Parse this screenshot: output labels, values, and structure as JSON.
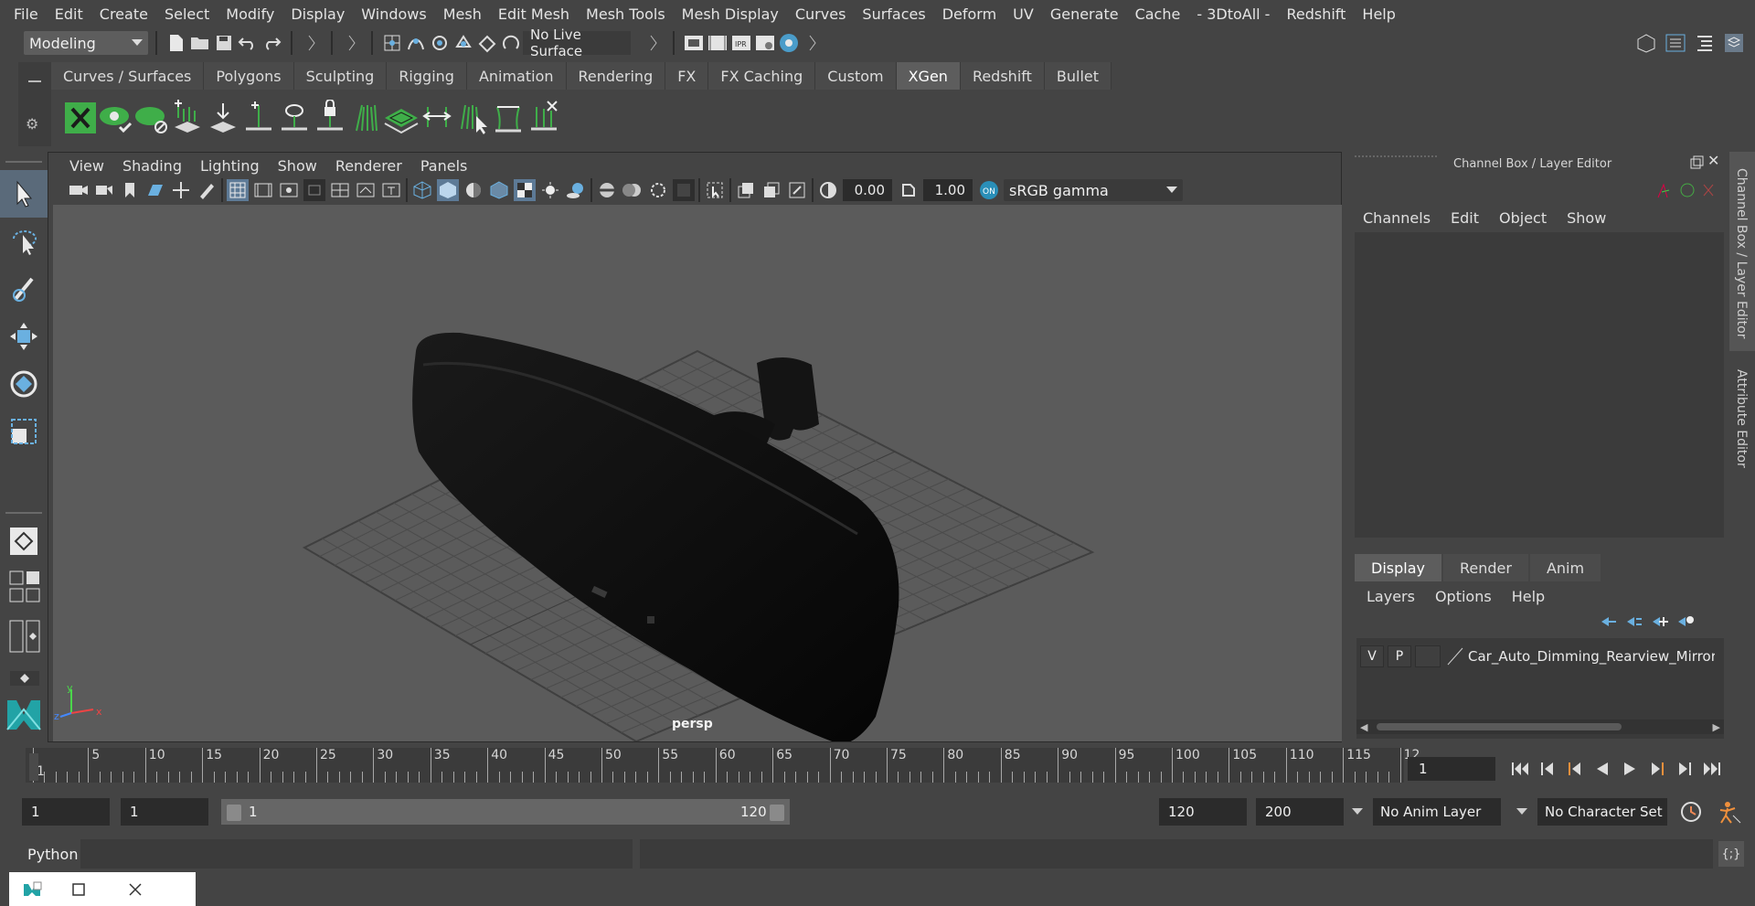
{
  "menubar": [
    "File",
    "Edit",
    "Create",
    "Select",
    "Modify",
    "Display",
    "Windows",
    "Mesh",
    "Edit Mesh",
    "Mesh Tools",
    "Mesh Display",
    "Curves",
    "Surfaces",
    "Deform",
    "UV",
    "Generate",
    "Cache",
    "- 3DtoAll -",
    "Redshift",
    "Help"
  ],
  "status": {
    "menuset": "Modeling",
    "live_surface": "No Live Surface"
  },
  "shelf": {
    "tabs": [
      "Curves / Surfaces",
      "Polygons",
      "Sculpting",
      "Rigging",
      "Animation",
      "Rendering",
      "FX",
      "FX Caching",
      "Custom",
      "XGen",
      "Redshift",
      "Bullet"
    ],
    "active_tab": "XGen"
  },
  "viewport": {
    "menu": [
      "View",
      "Shading",
      "Lighting",
      "Show",
      "Renderer",
      "Panels"
    ],
    "exposure": "0.00",
    "gamma": "1.00",
    "color_space": "sRGB gamma",
    "camera_label": "persp",
    "axis_y": "y",
    "axis_x": "x",
    "axis_z": "z"
  },
  "channel_box": {
    "title": "Channel Box / Layer Editor",
    "menu": [
      "Channels",
      "Edit",
      "Object",
      "Show"
    ]
  },
  "layer_editor": {
    "tabs": [
      "Display",
      "Render",
      "Anim"
    ],
    "active_tab": "Display",
    "menu": [
      "Layers",
      "Options",
      "Help"
    ],
    "layer": {
      "v": "V",
      "p": "P",
      "name": "Car_Auto_Dimming_Rearview_Mirror_"
    }
  },
  "side_tabs": {
    "channel_box": "Channel Box / Layer Editor",
    "attribute_editor": "Attribute Editor"
  },
  "timeline": {
    "ticks": [
      "1",
      "5",
      "10",
      "15",
      "20",
      "25",
      "30",
      "35",
      "40",
      "45",
      "50",
      "55",
      "60",
      "65",
      "70",
      "75",
      "80",
      "85",
      "90",
      "95",
      "100",
      "105",
      "110",
      "115",
      "12"
    ],
    "current_frame": "1"
  },
  "range": {
    "start_field": "1",
    "playback_start": "1",
    "slider_start": "1",
    "slider_end": "120",
    "playback_end": "120",
    "end_field": "200",
    "anim_layer": "No Anim Layer",
    "character_set": "No Character Set"
  },
  "command": {
    "language": "Python",
    "script_editor_label": "{;}"
  },
  "colors": {
    "accent_green": "#3fae49",
    "accent_blue": "#4a90c8",
    "active_tab": "#5d5d5d"
  }
}
